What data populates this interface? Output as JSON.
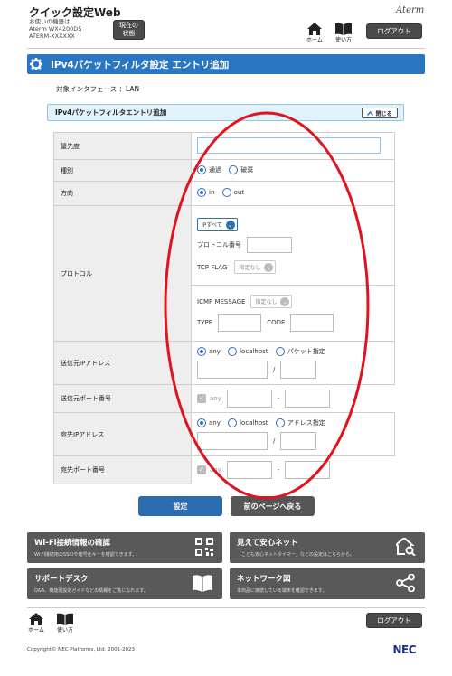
{
  "header": {
    "title": "クイック設定Web",
    "device_lines": [
      "お使いの機器は",
      "Aterm WX4200D5",
      "ATERM-XXXXXX"
    ],
    "status_button": [
      "現在の",
      "状態"
    ],
    "home_label": "ホーム",
    "manual_label": "使い方",
    "logout_label": "ログアウト",
    "logo": "Aterm"
  },
  "page": {
    "title": "IPv4パケットフィルタ設定 エントリ追加",
    "interface": "対象インタフェース ：LAN",
    "section_title": "IPv4パケットフィルタエントリ追加",
    "close_label": "閉じる"
  },
  "form": {
    "priority_label": "優先度",
    "type_label": "種別",
    "type_pass": "通過",
    "type_discard": "破棄",
    "direction_label": "方向",
    "dir_in": "in",
    "dir_out": "out",
    "protocol_label": "プロトコル",
    "protocol_select": "IPすべて",
    "protocol_number_label": "プロトコル番号",
    "tcp_flag_label": "TCP FLAG",
    "tcp_flag_select": "指定なし",
    "icmp_label": "ICMP MESSAGE",
    "icmp_select": "指定なし",
    "type_field_label": "TYPE",
    "code_field_label": "CODE",
    "src_ip_label": "送信元IPアドレス",
    "src_any": "any",
    "src_localhost": "localhost",
    "src_packet": "パケット指定",
    "src_port_label": "送信元ポート番号",
    "src_port_any": "any",
    "dst_ip_label": "宛先IPアドレス",
    "dst_any": "any",
    "dst_localhost": "localhost",
    "dst_addr": "アドレス指定",
    "dst_port_label": "宛先ポート番号",
    "dst_port_any": "any",
    "slash": "/",
    "dash": "-"
  },
  "actions": {
    "submit": "設定",
    "back": "前のページへ戻る"
  },
  "tiles": [
    {
      "title": "Wi-Fi接続情報の確認",
      "desc": "Wi-Fi接続用のSSIDや暗号化キーを確認できます。",
      "icon": "qr-code-icon"
    },
    {
      "title": "見えて安心ネット",
      "desc": "「こども安心ネットタイマー」などの設定はこちらから。",
      "icon": "house-search-icon"
    },
    {
      "title": "サポートデスク",
      "desc": "Q&A、機能別設定ガイドなどの情報をご覧になれます。",
      "icon": "book-icon"
    },
    {
      "title": "ネットワーク図",
      "desc": "本商品に接続している端末を確認できます。",
      "icon": "network-share-icon"
    }
  ],
  "footer": {
    "home_label": "ホーム",
    "manual_label": "使い方",
    "logout_label": "ログアウト",
    "copyright": "Copyright© NEC Platforms, Ltd. 2001-2023",
    "brand": "NEC"
  },
  "annotation": {
    "color": "#e0141e",
    "shape": "red-ellipse-overlay"
  }
}
